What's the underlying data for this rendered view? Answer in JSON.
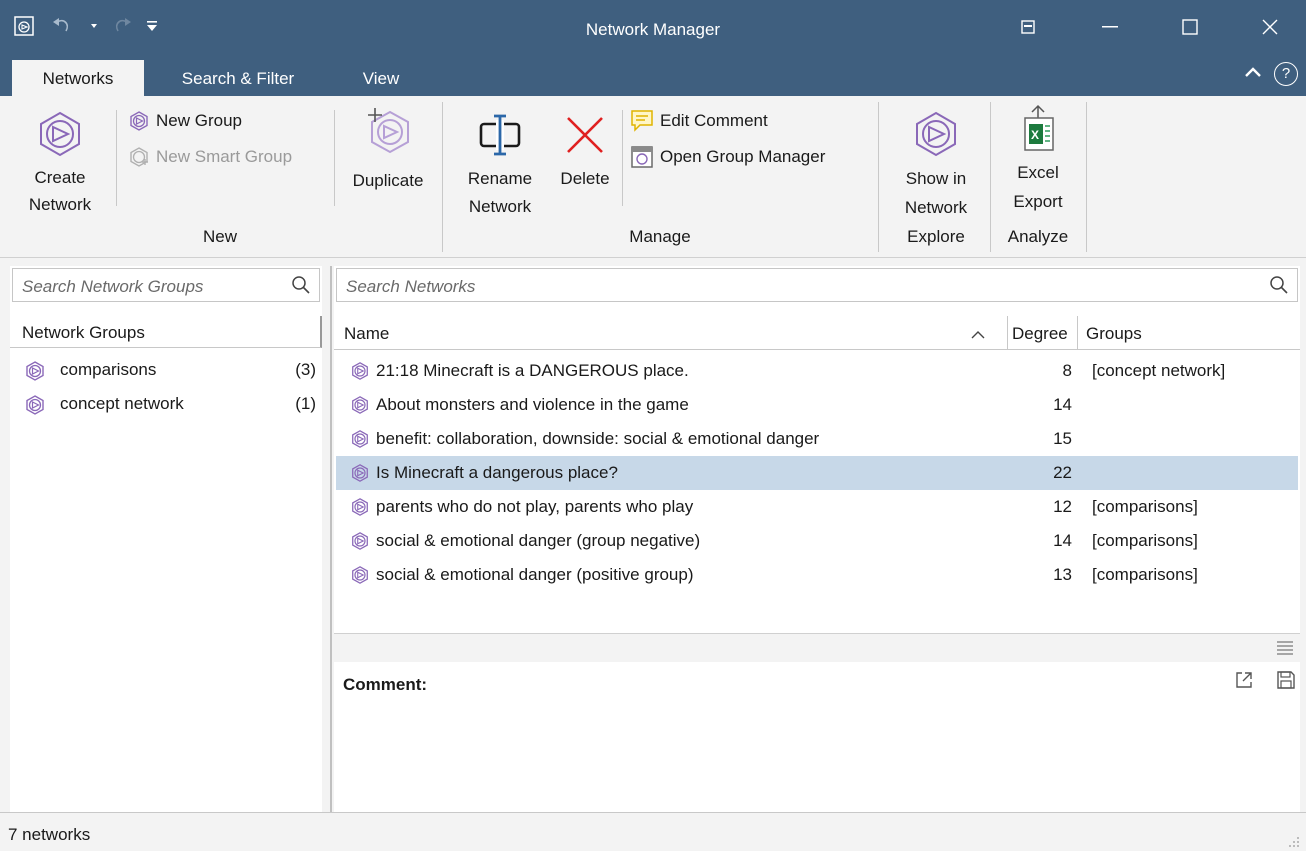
{
  "window": {
    "title": "Network Manager"
  },
  "tabs": [
    {
      "label": "Networks",
      "active": true
    },
    {
      "label": "Search & Filter",
      "active": false
    },
    {
      "label": "View",
      "active": false
    }
  ],
  "ribbon": {
    "create_network": {
      "line1": "Create",
      "line2": "Network"
    },
    "new_group": "New Group",
    "new_smart_group": "New Smart Group",
    "duplicate": "Duplicate",
    "group_new": "New",
    "rename_network": {
      "line1": "Rename",
      "line2": "Network"
    },
    "delete": "Delete",
    "edit_comment": "Edit Comment",
    "open_group_manager": "Open Group Manager",
    "group_manage": "Manage",
    "show_in_network": {
      "line1": "Show in",
      "line2": "Network"
    },
    "group_explore": "Explore",
    "excel_export": {
      "line1": "Excel",
      "line2": "Export"
    },
    "group_analyze": "Analyze"
  },
  "left_panel": {
    "search_placeholder": "Search Network Groups",
    "header": "Network Groups",
    "groups": [
      {
        "label": "comparisons",
        "count": "(3)"
      },
      {
        "label": "concept network",
        "count": "(1)"
      }
    ]
  },
  "right_panel": {
    "search_placeholder": "Search Networks",
    "columns": {
      "name": "Name",
      "degree": "Degree",
      "groups": "Groups"
    },
    "rows": [
      {
        "name": "21:18 Minecraft is a DANGEROUS place.",
        "degree": "8",
        "groups": "[concept network]"
      },
      {
        "name": "About monsters and violence in the game",
        "degree": "14",
        "groups": ""
      },
      {
        "name": "benefit: collaboration, downside: social & emotional danger",
        "degree": "15",
        "groups": ""
      },
      {
        "name": "Is Minecraft a dangerous place?",
        "degree": "22",
        "groups": ""
      },
      {
        "name": "parents who do not play, parents who play",
        "degree": "12",
        "groups": "[comparisons]"
      },
      {
        "name": "social & emotional danger (group negative)",
        "degree": "14",
        "groups": "[comparisons]"
      },
      {
        "name": "social & emotional danger (positive group)",
        "degree": "13",
        "groups": "[comparisons]"
      }
    ],
    "selected_row": 3,
    "comment_label": "Comment:"
  },
  "status": {
    "text": "7 networks"
  },
  "colors": {
    "titlebar": "#3f5f7f",
    "selection": "#c7d8e8",
    "network_icon": "#8a68b8",
    "delete_red": "#e02020"
  },
  "icons": {
    "app": "app-icon",
    "undo": "undo-icon",
    "redo": "redo-icon",
    "search": "search-icon",
    "network": "network-icon"
  }
}
